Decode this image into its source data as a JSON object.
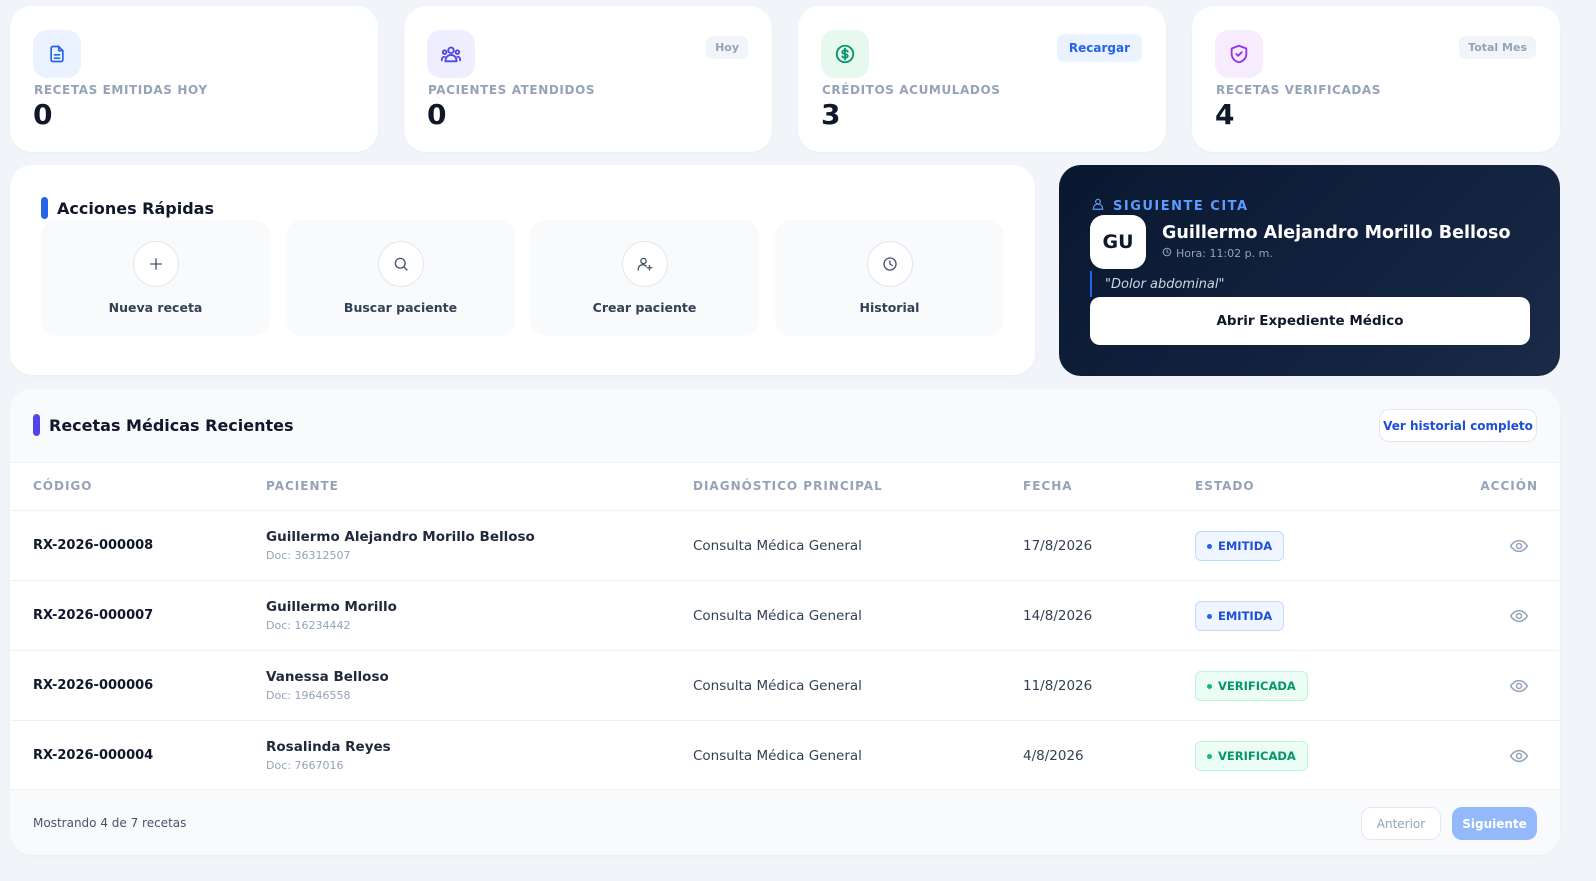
{
  "stats": [
    {
      "label": "RECETAS EMITIDAS HOY",
      "value": "0",
      "icon": "document-icon",
      "tag": ""
    },
    {
      "label": "PACIENTES ATENDIDOS",
      "value": "0",
      "icon": "users-icon",
      "tag": "Hoy"
    },
    {
      "label": "CRÉDITOS ACUMULADOS",
      "value": "3",
      "icon": "dollar-icon",
      "tag": "Recargar"
    },
    {
      "label": "RECETAS VERIFICADAS",
      "value": "4",
      "icon": "shield-check-icon",
      "tag": "Total Mes"
    }
  ],
  "quick_actions": {
    "title": "Acciones Rápidas",
    "items": [
      {
        "label": "Nueva receta",
        "icon": "plus-icon"
      },
      {
        "label": "Buscar paciente",
        "icon": "search-icon"
      },
      {
        "label": "Crear paciente",
        "icon": "user-plus-icon"
      },
      {
        "label": "Historial",
        "icon": "clock-icon"
      }
    ]
  },
  "next_appointment": {
    "heading": "SIGUIENTE CITA",
    "initials": "GU",
    "name": "Guillermo Alejandro Morillo Belloso",
    "time": "Hora: 11:02 p. m.",
    "reason": "\"Dolor abdominal\"",
    "button": "Abrir Expediente Médico"
  },
  "recent": {
    "title": "Recetas Médicas Recientes",
    "history_button": "Ver historial completo",
    "columns": [
      "CÓDIGO",
      "PACIENTE",
      "DIAGNÓSTICO PRINCIPAL",
      "FECHA",
      "ESTADO",
      "ACCIÓN"
    ],
    "rows": [
      {
        "code": "RX-2026-000008",
        "patient": "Guillermo Alejandro Morillo Belloso",
        "doc": "Doc: 36312507",
        "diagnosis": "Consulta Médica General",
        "date": "17/8/2026",
        "status": "EMITIDA"
      },
      {
        "code": "RX-2026-000007",
        "patient": "Guillermo Morillo",
        "doc": "Doc: 16234442",
        "diagnosis": "Consulta Médica General",
        "date": "14/8/2026",
        "status": "EMITIDA"
      },
      {
        "code": "RX-2026-000006",
        "patient": "Vanessa Belloso",
        "doc": "Doc: 19646558",
        "diagnosis": "Consulta Médica General",
        "date": "11/8/2026",
        "status": "VERIFICADA"
      },
      {
        "code": "RX-2026-000004",
        "patient": "Rosalinda Reyes",
        "doc": "Doc: 7667016",
        "diagnosis": "Consulta Médica General",
        "date": "4/8/2026",
        "status": "VERIFICADA"
      }
    ],
    "footer_info": "Mostrando 4 de 7 recetas",
    "prev_button": "Anterior",
    "next_button": "Siguiente"
  },
  "colors": {
    "accent": "#2563eb",
    "accent_violet": "#4f46e5",
    "success": "#059669",
    "dark_card": "#0a1730"
  }
}
